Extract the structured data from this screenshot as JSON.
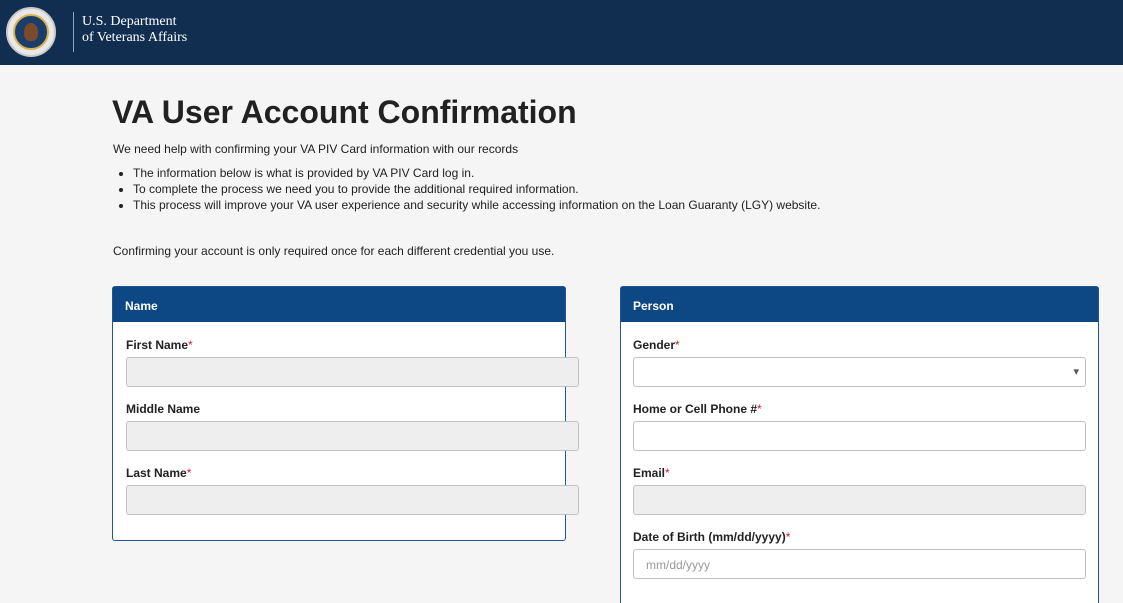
{
  "header": {
    "agency_line1": "U.S. Department",
    "agency_line2": "of Veterans Affairs"
  },
  "page": {
    "title": "VA User Account Confirmation",
    "intro": "We need help with confirming your VA PIV Card information with our records",
    "bullets": [
      "The information below is what is provided by VA PIV Card log in.",
      "To complete the process we need you to provide the additional required information.",
      "This process will improve your VA user experience and security while accessing information on the Loan Guaranty (LGY) website."
    ],
    "once_note": "Confirming your account is only required once for each different credential you use."
  },
  "name_panel": {
    "heading": "Name",
    "first_name_label": "First Name",
    "middle_name_label": "Middle Name",
    "last_name_label": "Last Name",
    "required_mark": "*"
  },
  "person_panel": {
    "heading": "Person",
    "gender_label": "Gender",
    "phone_label": "Home or Cell Phone #",
    "email_label": "Email",
    "dob_label": "Date of Birth (mm/dd/yyyy)",
    "dob_placeholder": "mm/dd/yyyy",
    "required_mark": "*"
  },
  "colors": {
    "header_bg": "#112e51",
    "panel_head_bg": "#0d4784",
    "required": "#cd2026"
  }
}
